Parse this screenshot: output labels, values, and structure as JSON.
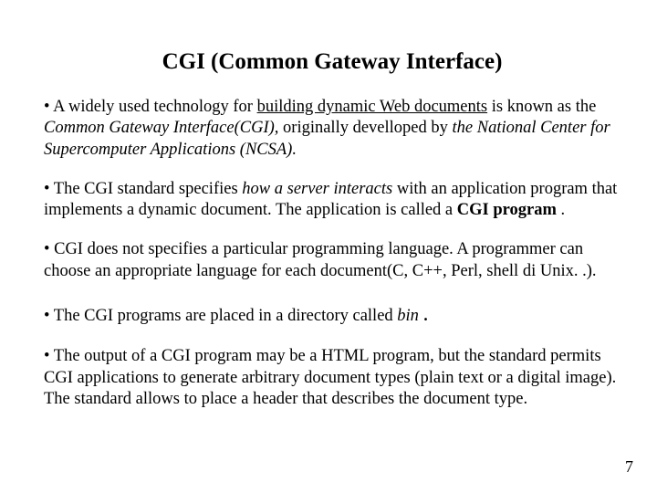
{
  "title": "CGI (Common Gateway Interface)",
  "p1": {
    "a": "• A widely used technology for ",
    "u": "building dynamic Web documents",
    "b": " is known as the ",
    "i1": "Common Gateway Interface(CGI),",
    "c": " originally develloped by ",
    "i2": "the National Center for Supercomputer Applications (NCSA)."
  },
  "p2": {
    "a": "• The CGI standard specifies ",
    "i": "how a server interacts",
    "b": " with an application program that implements a dynamic document. The application is called a ",
    "bold": "CGI program",
    "c": " ."
  },
  "p3": "• CGI does not specifies a particular programming language. A programmer can choose an appropriate language for each  document(C, C++, Perl, shell di Unix. .).",
  "p4": {
    "a": "• The CGI programs are placed in a directory called ",
    "i": "bin ",
    "dot": "."
  },
  "p5": {
    "a": "• The output of a CGI program may be a HTML program, but the standard permits CGI applications to generate arbitrary document types (plain text or a digital image).",
    "b": "The standard allows to place a header that describes the document type."
  },
  "page_number": "7"
}
